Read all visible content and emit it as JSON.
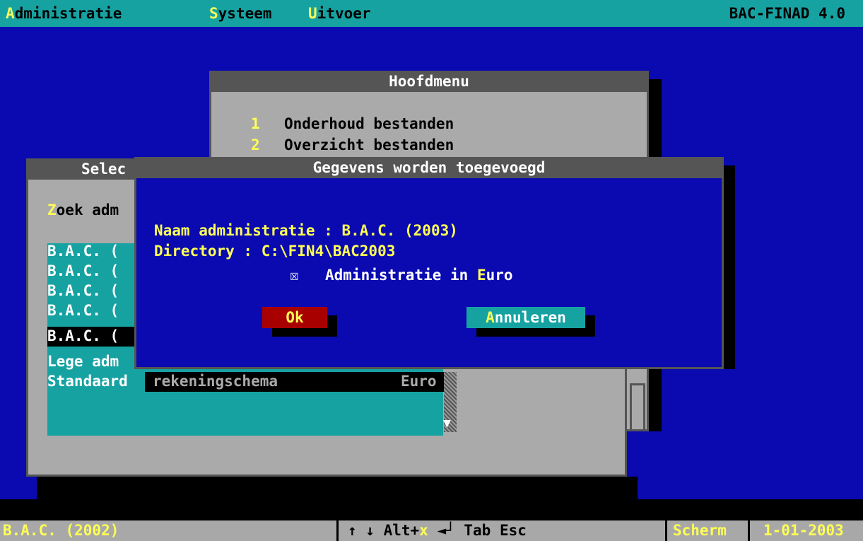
{
  "menubar": {
    "items": [
      {
        "hot": "A",
        "rest": "dministratie"
      },
      {
        "hot": "S",
        "rest": "ysteem"
      },
      {
        "hot": "U",
        "rest": "itvoer"
      }
    ],
    "version": "BAC-FINAD 4.0"
  },
  "hoofdmenu": {
    "title": "Hoofdmenu",
    "items": [
      {
        "num": "1",
        "label": "Onderhoud bestanden"
      },
      {
        "num": "2",
        "label": "Overzicht bestanden"
      }
    ]
  },
  "select_window": {
    "title": "Selec",
    "search_hot": "Z",
    "search_rest": "oek adm",
    "rows": [
      "B.A.C. (",
      "B.A.C. (",
      "B.A.C. (",
      "B.A.C. (",
      "B.A.C. (",
      "Lege adm",
      "Standaard"
    ],
    "row6_tail": "rekeningschema",
    "row6_currency": "Euro",
    "scroll_arrow": "▼"
  },
  "dialog": {
    "title": "Gegevens worden toegevoegd",
    "name_label": "Naam administratie : ",
    "name_value": "B.A.C. (2003)",
    "dir_label": "Directory : ",
    "dir_value": "C:\\FIN4\\BAC2003",
    "checkbox_glyph": "☒",
    "checkbox_label_pre": "Administratie in ",
    "checkbox_label_hot": "E",
    "checkbox_label_post": "uro",
    "ok_label": "Ok",
    "cancel_hot": "A",
    "cancel_rest": "nnuleren"
  },
  "statusbar": {
    "admin": "B.A.C. (2002)",
    "keys_pre": "↑ ↓ Alt+",
    "keys_x": "x",
    "keys_post": " ◄┘ Tab Esc",
    "screen": "Scherm",
    "date": "1-01-2003"
  },
  "colors": {
    "menubar": "#17a2a2",
    "desktop": "#0a0ab0",
    "highlight": "#ffff55",
    "ok_button": "#a80000",
    "cancel_button": "#17a2a2",
    "window": "#aaaaaa"
  }
}
